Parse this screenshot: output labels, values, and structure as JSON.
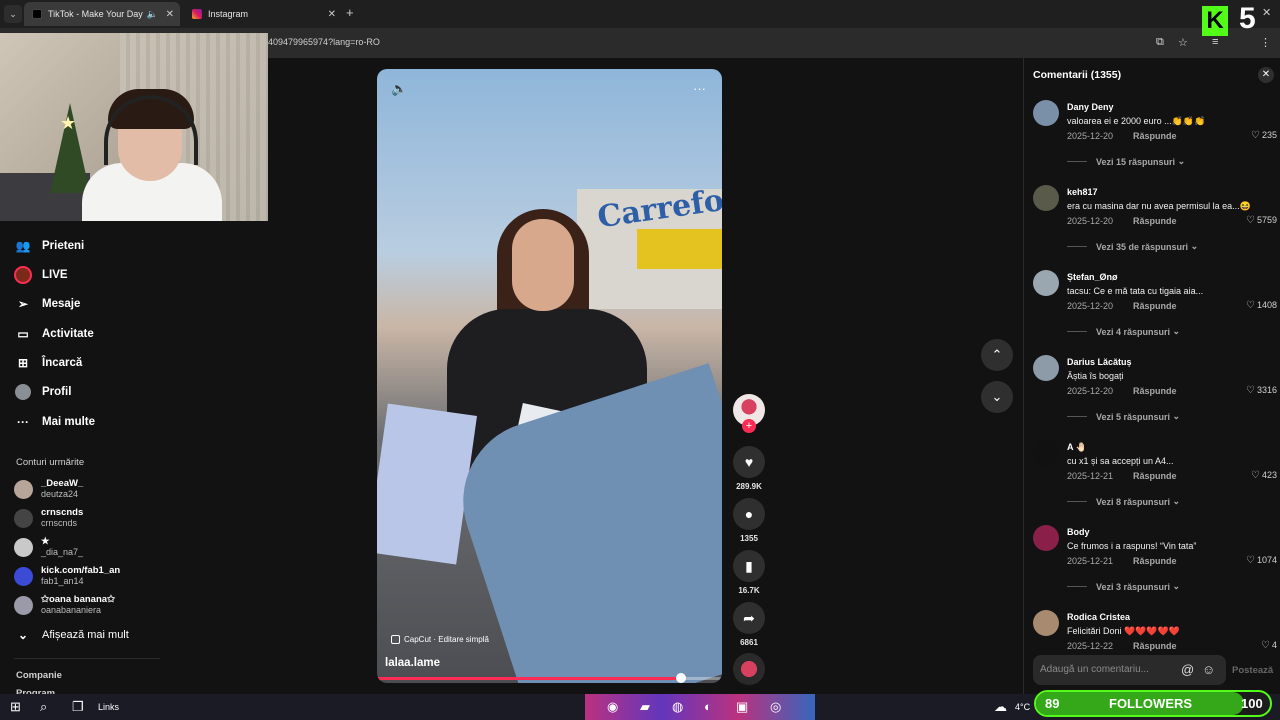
{
  "browser": {
    "tabs": [
      {
        "title": "TikTok - Make Your Day",
        "active": true
      },
      {
        "title": "Instagram",
        "active": false
      }
    ],
    "url": "409479965974?lang=ro-RO"
  },
  "sidebar": {
    "nav": [
      {
        "label": "Prieteni",
        "icon": "friends-icon"
      },
      {
        "label": "LIVE",
        "icon": "live-icon"
      },
      {
        "label": "Mesaje",
        "icon": "send-icon"
      },
      {
        "label": "Activitate",
        "icon": "activity-icon"
      },
      {
        "label": "Încarcă",
        "icon": "upload-icon"
      },
      {
        "label": "Profil",
        "icon": "profile-icon"
      },
      {
        "label": "Mai multe",
        "icon": "more-icon"
      }
    ],
    "following_title": "Conturi urmărite",
    "following": [
      {
        "name": "_DeeaW_",
        "handle": "deutza24"
      },
      {
        "name": "crnscnds",
        "handle": "crnscnds"
      },
      {
        "name": "★",
        "handle": "_dia_na7_"
      },
      {
        "name": "kick.com/fab1_an",
        "handle": "fab1_an14"
      },
      {
        "name": "✩oana banana✩",
        "handle": "oanabananiera"
      }
    ],
    "show_more": "Afișează mai mult",
    "company": "Companie",
    "program": "Program"
  },
  "video": {
    "username": "lalaa.lame",
    "capcut": "CapCut · Editare simplă",
    "progress": 0.88,
    "store_sign": "Carrefour"
  },
  "actions": {
    "likes": "289.9K",
    "comments": "1355",
    "saves": "16.7K",
    "shares": "6861"
  },
  "comments": {
    "title": "Comentarii (1355)",
    "reply_label": "Răspunde",
    "items": [
      {
        "user": "Dany Deny",
        "text": "valoarea ei e 2000 euro ...👏👏👏",
        "date": "2025-12-20",
        "likes": "235",
        "more": "Vezi 15 răspunsuri",
        "color": "#7a8fa8"
      },
      {
        "user": "keh817",
        "text": "era cu masina dar nu avea permisul la ea...😆",
        "date": "2025-12-20",
        "likes": "5759",
        "more": "Vezi 35 de răspunsuri",
        "color": "#5a5a4a"
      },
      {
        "user": "Ștefan_Ønø",
        "text": "tacsu: Ce e mă tata cu tigaia aia...",
        "date": "2025-12-20",
        "likes": "1408",
        "more": "Vezi 4 răspunsuri",
        "color": "#9aa6b0"
      },
      {
        "user": "Darius Lăcătuș",
        "text": "Ăștia îs bogați",
        "date": "2025-12-20",
        "likes": "3316",
        "more": "Vezi 5 răspunsuri",
        "color": "#8d9aa8"
      },
      {
        "user": "A 🤚🏻",
        "text": "cu x1 și sa accepți un A4...",
        "date": "2025-12-21",
        "likes": "423",
        "more": "Vezi 8 răspunsuri",
        "color": "#111111"
      },
      {
        "user": "Body",
        "text": "Ce frumos i a raspuns! “Vin tata”",
        "date": "2025-12-21",
        "likes": "1074",
        "more": "Vezi 3 răspunsuri",
        "color": "#8a1f4a"
      },
      {
        "user": "Rodica Cristea",
        "text": "Felicitări Doni ❤️❤️❤️❤️❤️",
        "date": "2025-12-22",
        "likes": "4",
        "more": "",
        "color": "#a88a70"
      }
    ],
    "input_placeholder": "Adaugă un comentariu...",
    "post_label": "Postează"
  },
  "taskbar": {
    "links": "Links",
    "temp": "4°C"
  },
  "overlay": {
    "followers_count": "89",
    "followers_label": "FOLLOWERS",
    "followers_goal": "100",
    "followers_progress": 0.89,
    "kick_letter": "K",
    "kick_number": "5"
  },
  "colors": {
    "accent": "#fe2c55",
    "kick_green": "#53fc18"
  }
}
